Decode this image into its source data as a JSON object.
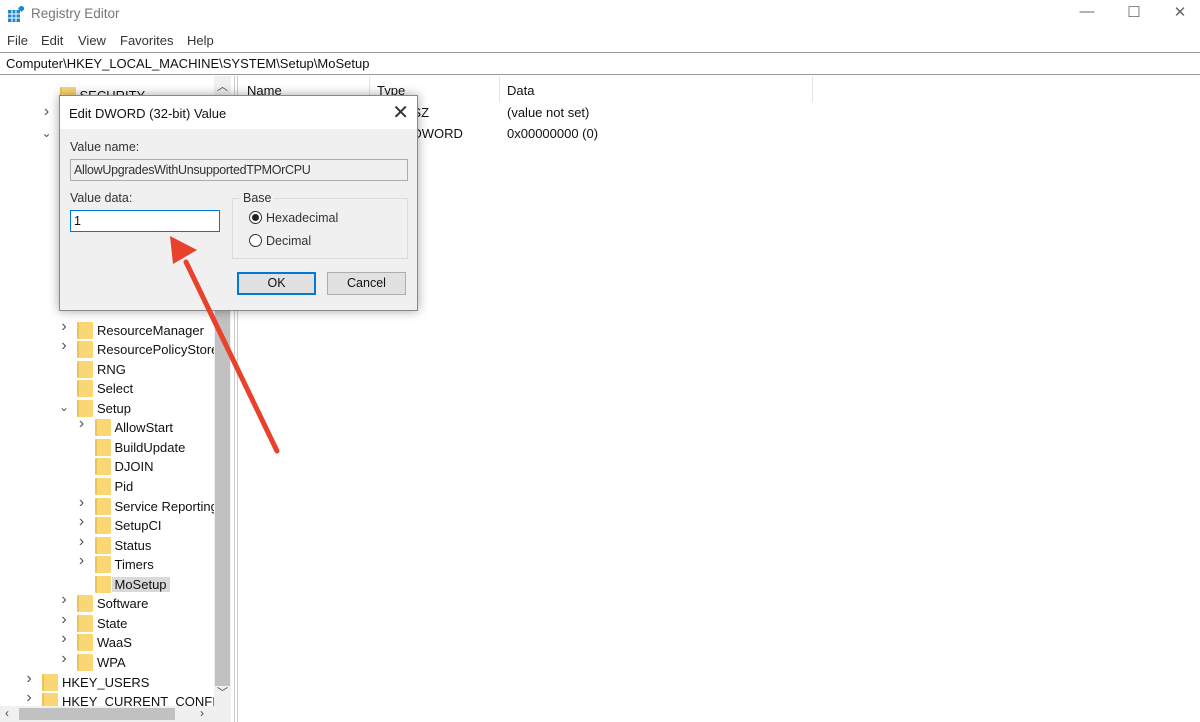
{
  "window": {
    "title": "Registry Editor",
    "minimize": "—",
    "maximize": "☐",
    "close": "✕"
  },
  "menu": [
    "File",
    "Edit",
    "View",
    "Favorites",
    "Help"
  ],
  "address": "Computer\\HKEY_LOCAL_MACHINE\\SYSTEM\\Setup\\MoSetup",
  "tree": [
    {
      "label": "SECURITY",
      "level": 2,
      "exp": "none"
    },
    {
      "label": "",
      "level": 2,
      "exp": "collapsed"
    },
    {
      "label": "",
      "level": 2,
      "exp": "expanded"
    },
    {
      "label": "",
      "level": 3,
      "exp": "hidden"
    },
    {
      "label": "",
      "level": 3,
      "exp": "hidden"
    },
    {
      "label": "",
      "level": 3,
      "exp": "hidden"
    },
    {
      "label": "",
      "level": 3,
      "exp": "hidden"
    },
    {
      "label": "",
      "level": 3,
      "exp": "hidden"
    },
    {
      "label": "",
      "level": 3,
      "exp": "hidden"
    },
    {
      "label": "",
      "level": 3,
      "exp": "hidden"
    },
    {
      "label": "",
      "level": 3,
      "exp": "hidden"
    },
    {
      "label": "",
      "level": 3,
      "exp": "hidden"
    },
    {
      "label": "ResourceManager",
      "level": 3,
      "exp": "collapsed"
    },
    {
      "label": "ResourcePolicyStore",
      "level": 3,
      "exp": "collapsed"
    },
    {
      "label": "RNG",
      "level": 3,
      "exp": "none"
    },
    {
      "label": "Select",
      "level": 3,
      "exp": "none"
    },
    {
      "label": "Setup",
      "level": 3,
      "exp": "expanded"
    },
    {
      "label": "AllowStart",
      "level": 4,
      "exp": "collapsed"
    },
    {
      "label": "BuildUpdate",
      "level": 4,
      "exp": "none"
    },
    {
      "label": "DJOIN",
      "level": 4,
      "exp": "none"
    },
    {
      "label": "Pid",
      "level": 4,
      "exp": "none"
    },
    {
      "label": "Service Reporting",
      "level": 4,
      "exp": "collapsed"
    },
    {
      "label": "SetupCI",
      "level": 4,
      "exp": "collapsed"
    },
    {
      "label": "Status",
      "level": 4,
      "exp": "collapsed"
    },
    {
      "label": "Timers",
      "level": 4,
      "exp": "collapsed"
    },
    {
      "label": "MoSetup",
      "level": 4,
      "exp": "none",
      "selected": true
    },
    {
      "label": "Software",
      "level": 3,
      "exp": "collapsed"
    },
    {
      "label": "State",
      "level": 3,
      "exp": "collapsed"
    },
    {
      "label": "WaaS",
      "level": 3,
      "exp": "collapsed"
    },
    {
      "label": "WPA",
      "level": 3,
      "exp": "collapsed"
    },
    {
      "label": "HKEY_USERS",
      "level": 1,
      "exp": "collapsed"
    },
    {
      "label": "HKEY_CURRENT_CONFIG",
      "level": 1,
      "exp": "collapsed"
    }
  ],
  "list": {
    "columns": [
      "Name",
      "Type",
      "Data"
    ],
    "rows": [
      {
        "type": "REG_SZ",
        "data": "(value not set)"
      },
      {
        "type": "REG_DWORD",
        "data": "0x00000000 (0)"
      }
    ]
  },
  "dialog": {
    "title": "Edit DWORD (32-bit) Value",
    "value_name_label": "Value name:",
    "value_name": "AllowUpgradesWithUnsupportedTPMOrCPU",
    "value_data_label": "Value data:",
    "value_data": "1",
    "base_label": "Base",
    "base_options": [
      "Hexadecimal",
      "Decimal"
    ],
    "base_selected": "Hexadecimal",
    "ok": "OK",
    "cancel": "Cancel"
  },
  "annotation_color": "#e8412c"
}
